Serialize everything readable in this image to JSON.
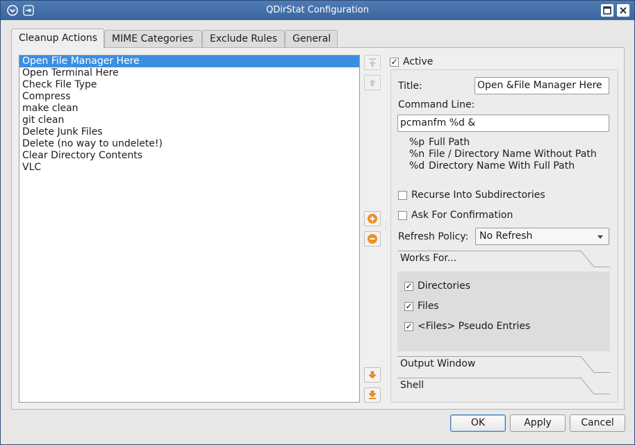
{
  "window": {
    "title": "QDirStat Configuration"
  },
  "tabs": [
    {
      "label": "Cleanup Actions"
    },
    {
      "label": "MIME Categories"
    },
    {
      "label": "Exclude Rules"
    },
    {
      "label": "General"
    }
  ],
  "cleanups": [
    "Open File Manager Here",
    "Open Terminal Here",
    "Check File Type",
    "Compress",
    "make clean",
    "git clean",
    "Delete Junk Files",
    "Delete (no way to undelete!)",
    "Clear Directory Contents",
    "VLC"
  ],
  "detail": {
    "active_label": "Active",
    "title_label": "Title:",
    "title_value": "Open &File Manager Here",
    "command_label": "Command Line:",
    "command_value": "pcmanfm %d &",
    "help": [
      {
        "code": "%p",
        "text": "Full Path"
      },
      {
        "code": "%n",
        "text": "File / Directory Name Without Path"
      },
      {
        "code": "%d",
        "text": "Directory Name With Full Path"
      }
    ],
    "recurse_label": "Recurse Into Subdirectories",
    "confirm_label": "Ask For Confirmation",
    "refresh_label": "Refresh Policy:",
    "refresh_value": "No Refresh",
    "works_for": {
      "header": "Works For...",
      "directories": "Directories",
      "files": "Files",
      "pseudo": "<Files> Pseudo Entries"
    },
    "output_window_header": "Output Window",
    "shell_header": "Shell"
  },
  "buttons": {
    "ok": "OK",
    "apply": "Apply",
    "cancel": "Cancel"
  },
  "colors": {
    "titlebar": "#3f6da8",
    "selection": "#3d8ee0",
    "accent_orange": "#f0901e"
  }
}
